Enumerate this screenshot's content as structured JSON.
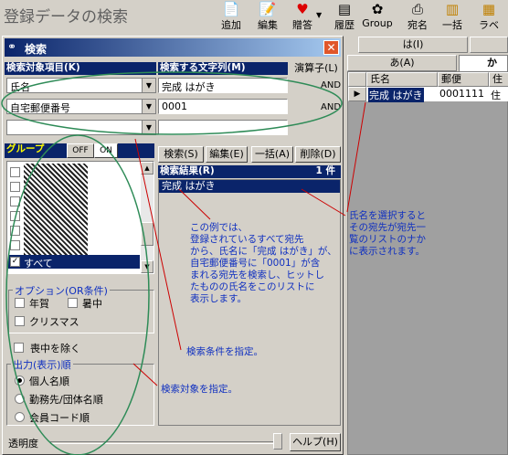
{
  "page_title": "登録データの検索",
  "toolbar": [
    {
      "label": "追加",
      "icon": "add-icon"
    },
    {
      "label": "編集",
      "icon": "edit-icon"
    },
    {
      "label": "贈答",
      "icon": "gift-icon"
    },
    {
      "label": "履歴",
      "icon": "history-icon"
    },
    {
      "label": "Group",
      "icon": "group-icon"
    },
    {
      "label": "宛名",
      "icon": "printer-icon"
    },
    {
      "label": "一括",
      "icon": "batch-icon"
    },
    {
      "label": "ラベ",
      "icon": "label-icon"
    }
  ],
  "dialog": {
    "title": "検索",
    "col_item": "検索対象項目(K)",
    "col_text": "検索する文字列(M)",
    "col_op": "演算子(L)",
    "rows": [
      {
        "item": "氏名",
        "text": "完成 はがき",
        "op": "AND"
      },
      {
        "item": "自宅郵便番号",
        "text": "0001",
        "op": "AND"
      },
      {
        "item": "",
        "text": "",
        "op": ""
      }
    ],
    "group_label": "グループ",
    "group_off": "OFF",
    "group_on": "ON",
    "group_selected": "すべて",
    "buttons": {
      "search": "検索(S)",
      "edit": "編集(E)",
      "batch": "一括(A)",
      "delete": "削除(D)"
    },
    "results_header": "検索結果(R)",
    "results_count": "1 件",
    "results": [
      "完成 はがき"
    ],
    "options_title": "オプション(OR条件)",
    "option_nenga": "年賀",
    "option_shochu": "暑中",
    "option_christmas": "クリスマス",
    "mourning": "喪中を除く",
    "output_title": "出力(表示)順",
    "order_options": [
      "個人名順",
      "勤務先/団体名順",
      "会員コード順"
    ],
    "order_selected": 0,
    "transparency": "透明度",
    "help": "ヘルプ(H)"
  },
  "right_panel": {
    "tab_ha": "は(I)",
    "tab_a": "あ(A)",
    "tab_ka": "か",
    "col_name": "氏名",
    "col_zip": "郵便",
    "col_addr": "住",
    "row": {
      "name": "完成 はがき",
      "zip": "0001111",
      "addr": "住"
    }
  },
  "annotations": {
    "result_note": [
      "この例では、",
      "登録されているすべて宛先",
      "から、氏名に「完成 はがき」が、",
      "自宅郵便番号に「0001」が含",
      "まれる宛先を検索し、ヒットし",
      "たものの氏名をこのリストに",
      "表示します。"
    ],
    "select_note": [
      "氏名を選択すると",
      "その宛先が宛先一",
      "覧のリストのナか",
      "に表示されます。"
    ],
    "condition_note": "検索条件を指定。",
    "target_note": "検索対象を指定。"
  },
  "colors": {
    "title_bar": "#0a246a",
    "selection": "#0a246a",
    "annotation": "#1030c0",
    "ellipse": "#2e8b57",
    "arrow": "#cc0000"
  }
}
